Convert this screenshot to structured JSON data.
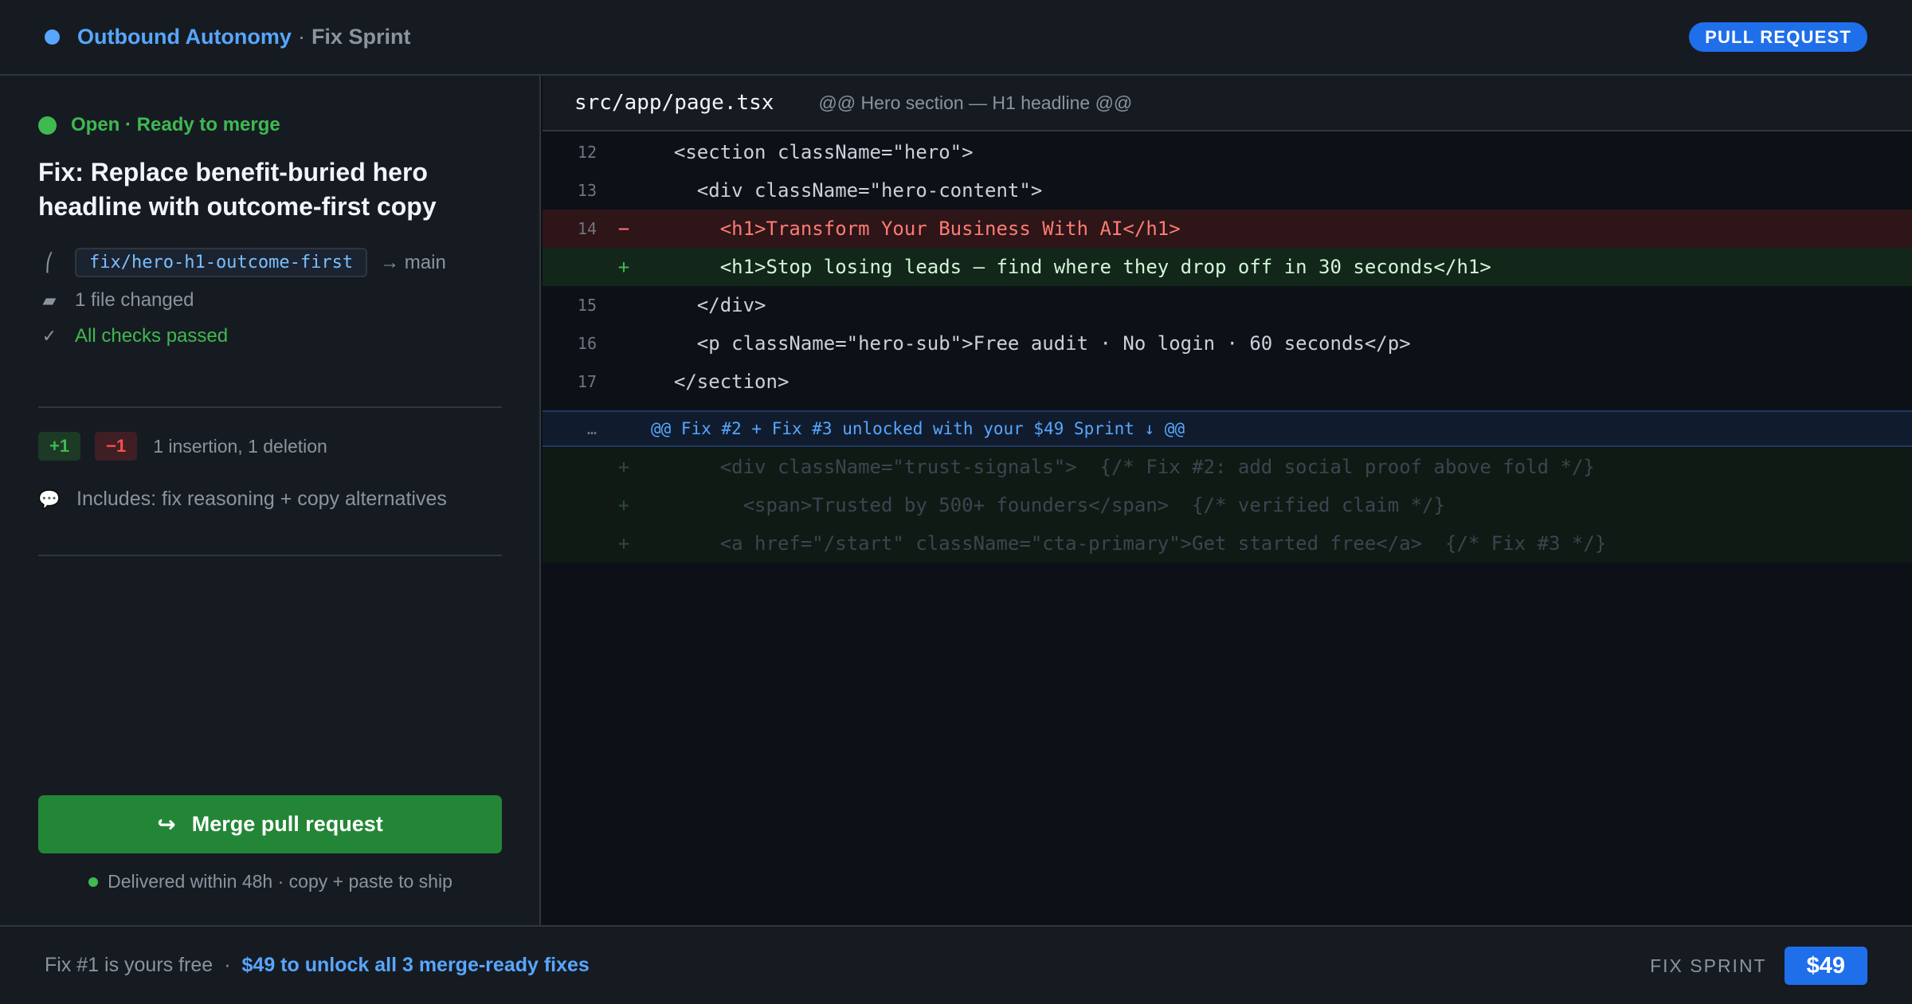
{
  "header": {
    "brand": "Outbound Autonomy",
    "separator": "·",
    "subtitle": "Fix Sprint",
    "pill": "PULL REQUEST"
  },
  "pr": {
    "status": "Open · Ready to merge",
    "title": "Fix: Replace benefit-buried hero headline with outcome-first copy",
    "branch": "fix/hero-h1-outcome-first",
    "target": "→ main",
    "files_changed": "1 file changed",
    "checks": "All checks passed",
    "additions": "+1",
    "deletions": "−1",
    "change_summary": "1 insertion, 1 deletion",
    "includes": "Includes: fix reasoning + copy alternatives",
    "merge_label": "Merge pull request",
    "delivered": "Delivered within 48h · copy + paste to ship"
  },
  "diff": {
    "file_path": "src/app/page.tsx",
    "hunk": "@@ Hero section — H1 headline @@",
    "lines": [
      {
        "num": "12",
        "sign": "",
        "code": "  <section className=\"hero\">"
      },
      {
        "num": "13",
        "sign": "",
        "code": "    <div className=\"hero-content\">"
      },
      {
        "num": "14",
        "sign": "−",
        "code": "      <h1>Transform Your Business With AI</h1>"
      },
      {
        "num": "",
        "sign": "+",
        "code": "      <h1>Stop losing leads — find where they drop off in 30 seconds</h1>"
      },
      {
        "num": "15",
        "sign": "",
        "code": "    </div>"
      },
      {
        "num": "16",
        "sign": "",
        "code": "    <p className=\"hero-sub\">Free audit · No login · 60 seconds</p>"
      },
      {
        "num": "17",
        "sign": "",
        "code": "  </section>"
      }
    ],
    "expand_dots": "…",
    "expand_text": "@@ Fix #2 + Fix #3 unlocked with your $49 Sprint ↓ @@",
    "locked_lines": [
      {
        "sign": "+",
        "code": "      <div className=\"trust-signals\">  {/* Fix #2: add social proof above fold */}"
      },
      {
        "sign": "+",
        "code": "        <span>Trusted by 500+ founders</span>  {/* verified claim */}"
      },
      {
        "sign": "+",
        "code": "      <a href=\"/start\" className=\"cta-primary\">Get started free</a>  {/* Fix #3 */}"
      }
    ]
  },
  "footer": {
    "free": "Fix #1 is yours free",
    "separator": "·",
    "cta": "$49 to unlock all 3 merge-ready fixes",
    "label": "FIX SPRINT",
    "price": "$49"
  }
}
